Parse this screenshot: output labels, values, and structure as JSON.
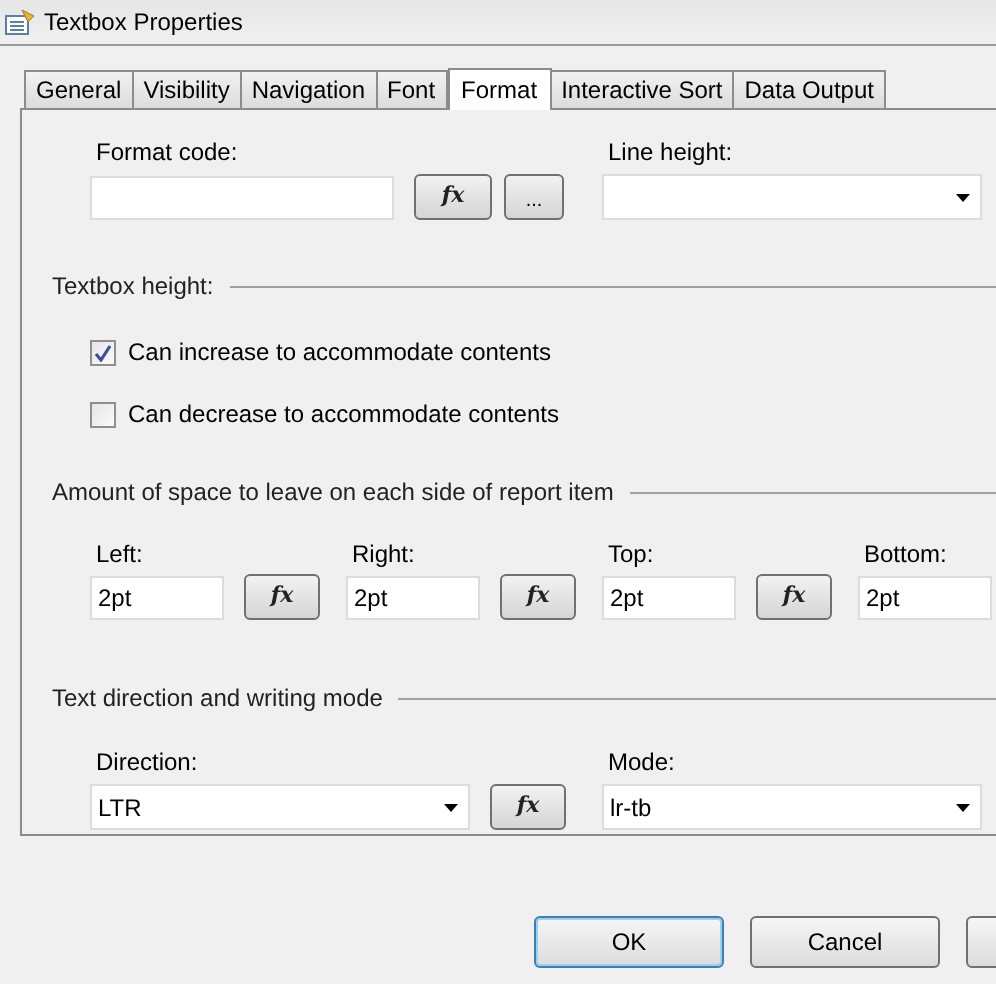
{
  "window": {
    "title": "Textbox Properties"
  },
  "tabs": [
    {
      "label": "General",
      "selected": false
    },
    {
      "label": "Visibility",
      "selected": false
    },
    {
      "label": "Navigation",
      "selected": false
    },
    {
      "label": "Font",
      "selected": false
    },
    {
      "label": "Format",
      "selected": true
    },
    {
      "label": "Interactive Sort",
      "selected": false
    },
    {
      "label": "Data Output",
      "selected": false
    }
  ],
  "format": {
    "format_code": {
      "label": "Format code:"
    },
    "fx_button": "fx",
    "browse_button": "...",
    "line_height": {
      "label": "Line height:"
    }
  },
  "textbox_height": {
    "heading": "Textbox height:",
    "options": [
      {
        "label": "Can increase to accommodate contents",
        "checked": true
      },
      {
        "label": "Can decrease to accommodate contents",
        "checked": false
      }
    ]
  },
  "spacing": {
    "heading": "Amount of space to leave on each side of report item",
    "fields": [
      {
        "label": "Left:",
        "value": "2pt",
        "fx_button": "fx"
      },
      {
        "label": "Right:",
        "value": "2pt",
        "fx_button": "fx"
      },
      {
        "label": "Top:",
        "value": "2pt",
        "fx_button": "fx"
      },
      {
        "label": "Bottom:",
        "value": "2pt"
      }
    ]
  },
  "direction": {
    "heading": "Text direction and writing mode",
    "direction": {
      "label": "Direction:",
      "value": "LTR",
      "fx_button": "fx"
    },
    "mode": {
      "label": "Mode:",
      "value": "lr-tb"
    }
  },
  "buttons": [
    "OK",
    "Cancel"
  ]
}
